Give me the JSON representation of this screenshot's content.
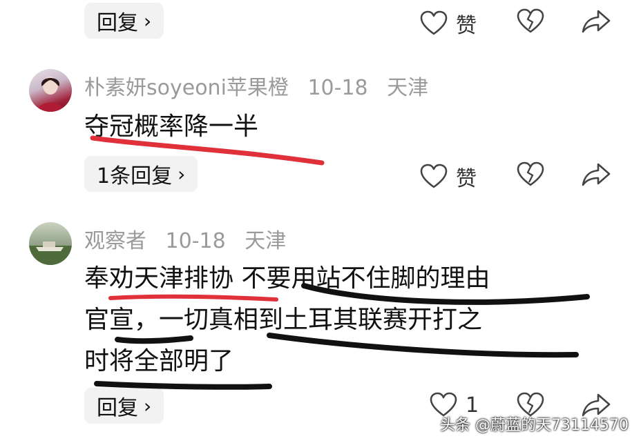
{
  "top": {
    "reply_label": "回复",
    "like_label": "赞"
  },
  "comment1": {
    "username": "朴素妍soyeoni苹果橙",
    "date": "10-18",
    "location": "天津",
    "text": "夺冠概率降一半",
    "reply_label": "1条回复",
    "like_label": "赞"
  },
  "comment2": {
    "username": "观察者",
    "date": "10-18",
    "location": "天津",
    "lines": [
      "奉劝天津排协 不要用站不住脚的理由",
      "官宣，一切真相到土耳其联赛开打之",
      "时将全部明了"
    ],
    "reply_label": "回复",
    "like_count": "1"
  },
  "watermark": "头条 @蔚蓝的天73114570",
  "colors": {
    "red_underline": "#e0303a",
    "black_underline": "#111111",
    "meta_gray": "#9a9a9a",
    "button_bg": "#f2f2f2"
  },
  "icons": [
    "heart-icon",
    "broken-heart-icon",
    "share-icon",
    "chevron-right-icon"
  ]
}
